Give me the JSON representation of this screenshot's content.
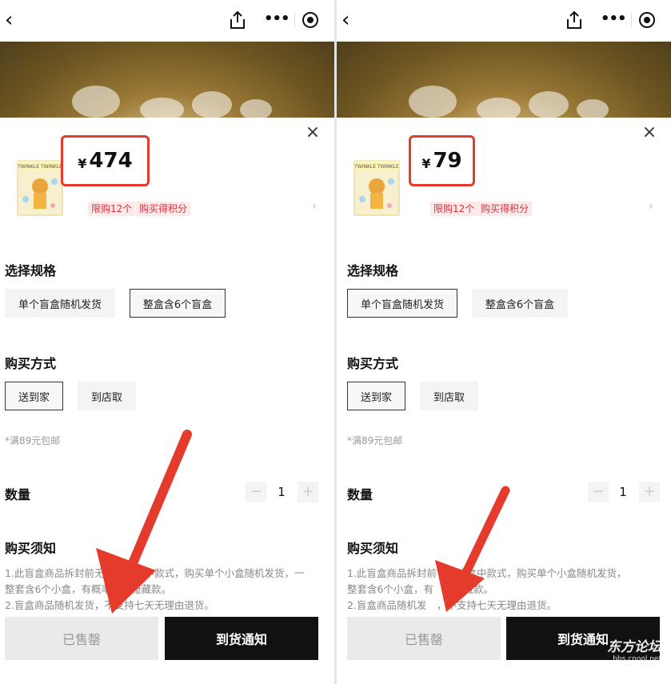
{
  "left": {
    "price_currency": "¥",
    "price_value": "474",
    "spec_selected": "整盒含6个盲盒"
  },
  "right": {
    "price_currency": "¥",
    "price_value": "79",
    "spec_selected": "单个盲盒随机发货"
  },
  "common": {
    "back_icon": "back-chevron-icon",
    "share_icon": "share-icon",
    "more_icon": "more-dots-icon",
    "close_icon": "close-icon",
    "tag_limit": "限购12个",
    "tag_points": "购买得积分",
    "spec_title": "选择规格",
    "spec_options": [
      "单个盲盒随机发货",
      "整盒含6个盲盒"
    ],
    "purchase_title": "购买方式",
    "purchase_options": [
      "送到家",
      "到店取"
    ],
    "shipping_note": "*满89元包邮",
    "quantity_label": "数量",
    "quantity_value": "1",
    "minus": "−",
    "plus": "+",
    "notice_title": "购买须知",
    "notice_left_line1": "1.此盲盒商品拆封前无人",
    "notice_left_line1b": "盒中款式，购买单个小盒随机发货，一",
    "notice_left_line2a": "整套含6个小盒，有概率",
    "notice_left_line2b": "隐藏款。",
    "notice_left_line3": "2.盲盒商品随机发货，不支持七天无理由退货。",
    "notice_right_line1a": "1.此盲盒商品拆封前",
    "notice_right_line1b": "晓盒中款式，购买单个小盒随机发货，",
    "notice_right_line2a": "整套含6个小盒，有",
    "notice_right_line2b": "隐藏款。",
    "notice_right_line3a": "2.盲盒商品随机发",
    "notice_right_line3b": "，不支持七天无理由退货。",
    "sold_out": "已售罄",
    "notify": "到货通知",
    "thumb_text": "TWINKLE TWINKLE"
  },
  "watermark": {
    "main": "东方论坛",
    "sub": "bbs.cnool.net"
  },
  "colors": {
    "accent_red": "#e53b2c",
    "tag_bg": "#fde9ea",
    "tag_text": "#d8323c",
    "button_dark": "#111111"
  }
}
